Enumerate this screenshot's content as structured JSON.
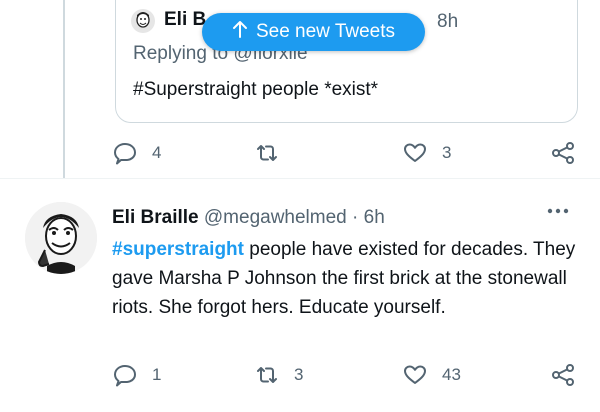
{
  "quoted_tweet": {
    "author_name": "Eli B",
    "time": "8h",
    "replying_to": "Replying to @florxlle",
    "text": "#Superstraight people *exist*"
  },
  "toast": {
    "label": "See new Tweets",
    "icon": "arrow-up-icon"
  },
  "parent_actions": {
    "reply_count": "4",
    "retweet_count": "",
    "like_count": "3"
  },
  "tweet": {
    "author_name": "Eli Braille",
    "handle": "@megawhelmed",
    "separator": "·",
    "time": "6h",
    "hashtag": "#superstraight",
    "text_rest": " people have existed for decades. They gave Marsha P Johnson the first brick at the stonewall riots. She forgot hers. Educate yourself.",
    "actions": {
      "reply_count": "1",
      "retweet_count": "3",
      "like_count": "43"
    }
  },
  "colors": {
    "accent": "#1d9bf0",
    "secondary_text": "#536471",
    "border": "#cfd9de"
  }
}
